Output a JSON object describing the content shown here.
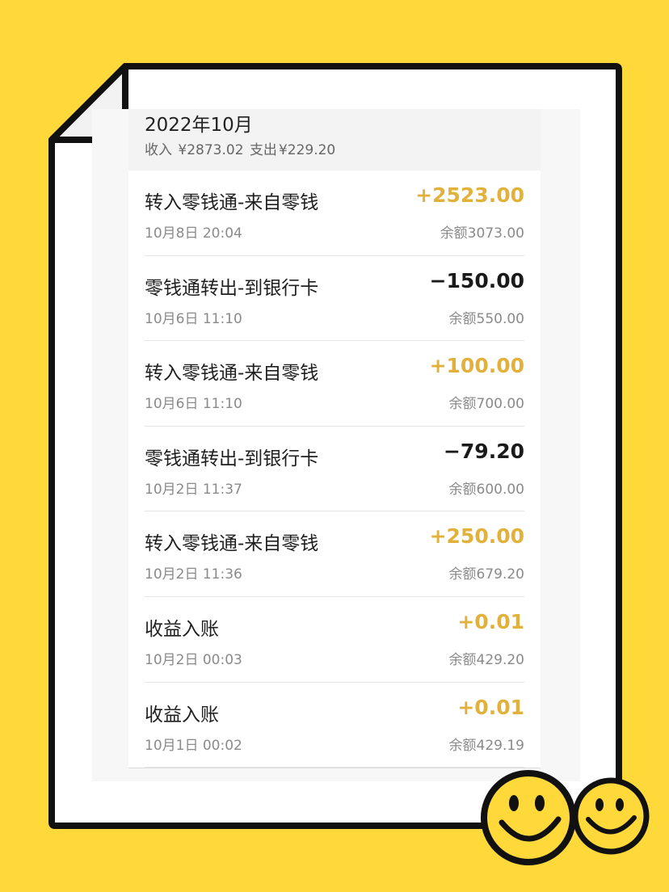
{
  "header": {
    "month": "2022年10月",
    "income_label": "收入",
    "income_value": "¥2873.02",
    "expense_label": "支出",
    "expense_value": "¥229.20"
  },
  "transactions": [
    {
      "title": "转入零钱通-来自零钱",
      "time": "10月8日 20:04",
      "amount": "+2523.00",
      "balance": "余额3073.00",
      "direction": "in"
    },
    {
      "title": "零钱通转出-到银行卡",
      "time": "10月6日 11:10",
      "amount": "−150.00",
      "balance": "余额550.00",
      "direction": "out"
    },
    {
      "title": "转入零钱通-来自零钱",
      "time": "10月6日 11:10",
      "amount": "+100.00",
      "balance": "余额700.00",
      "direction": "in"
    },
    {
      "title": "零钱通转出-到银行卡",
      "time": "10月2日 11:37",
      "amount": "−79.20",
      "balance": "余额600.00",
      "direction": "out"
    },
    {
      "title": "转入零钱通-来自零钱",
      "time": "10月2日 11:36",
      "amount": "+250.00",
      "balance": "余额679.20",
      "direction": "in"
    },
    {
      "title": "收益入账",
      "time": "10月2日 00:03",
      "amount": "+0.01",
      "balance": "余额429.20",
      "direction": "in"
    },
    {
      "title": "收益入账",
      "time": "10月1日 00:02",
      "amount": "+0.01",
      "balance": "余额429.19",
      "direction": "in"
    }
  ],
  "colors": {
    "background": "#FFD83A",
    "income_amount": "#E1B13A",
    "expense_amount": "#1a1a1a",
    "smiley": "#FFD83A"
  },
  "decorations": {
    "icons": [
      "paper-sheet-icon",
      "smiley-face-icon",
      "smiley-face-icon"
    ]
  }
}
